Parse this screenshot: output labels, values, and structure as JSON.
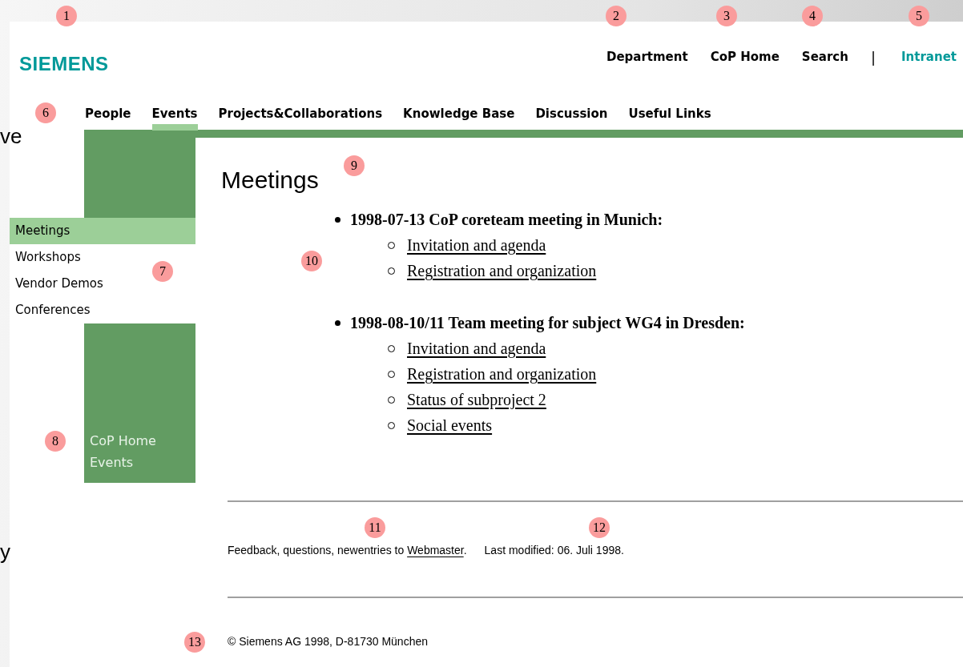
{
  "slide_fragments": [
    "ve",
    "y"
  ],
  "header": {
    "logo": "SIEMENS",
    "links": [
      {
        "label": "Department",
        "kind": "plain"
      },
      {
        "label": "CoP Home",
        "kind": "plain"
      },
      {
        "label": "Search",
        "kind": "plain"
      },
      {
        "label": "|",
        "kind": "separator"
      },
      {
        "label": "Intranet",
        "kind": "accent"
      }
    ]
  },
  "nav": [
    {
      "label": "People",
      "selected": false
    },
    {
      "label": "Events",
      "selected": true
    },
    {
      "label": "Projects&Collaborations",
      "selected": false
    },
    {
      "label": "Knowledge Base",
      "selected": false
    },
    {
      "label": "Discussion",
      "selected": false
    },
    {
      "label": "Useful Links",
      "selected": false
    }
  ],
  "sidebar": {
    "items": [
      {
        "label": "Meetings",
        "selected": true
      },
      {
        "label": "Workshops",
        "selected": false
      },
      {
        "label": "Vendor Demos",
        "selected": false
      },
      {
        "label": "Conferences",
        "selected": false
      }
    ],
    "box_lines": [
      "CoP Home",
      "Events"
    ]
  },
  "content": {
    "title": "Meetings",
    "meetings": [
      {
        "title": "1998-07-13 CoP coreteam meeting in Munich:",
        "links": [
          "Invitation and agenda",
          "Registration and organization"
        ]
      },
      {
        "title": "1998-08-10/11 Team meeting for subject WG4 in Dresden:",
        "links": [
          "Invitation and agenda",
          "Registration and organization",
          "Status of subproject 2",
          "Social events"
        ]
      }
    ]
  },
  "footer": {
    "feedback_before": "Feedback, questions, newentries to ",
    "feedback_link": "Webmaster",
    "feedback_after": ".",
    "last_modified": "Last modified: 06. Juli 1998.",
    "copyright": "© Siemens AG 1998, D-81730 München"
  },
  "markers": [
    "1",
    "2",
    "3",
    "4",
    "5",
    "6",
    "7",
    "8",
    "9",
    "10",
    "11",
    "12",
    "13"
  ]
}
